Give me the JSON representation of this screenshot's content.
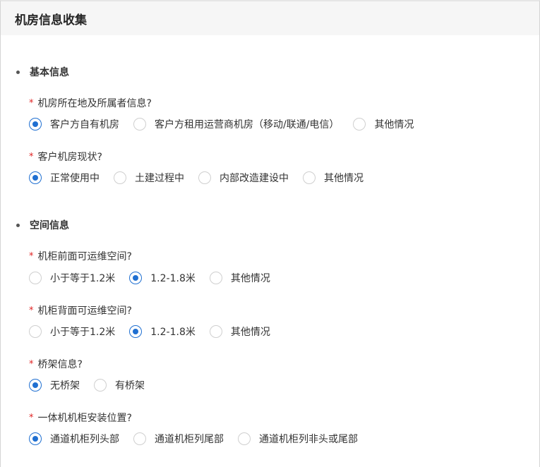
{
  "header": {
    "title": "机房信息收集"
  },
  "sections": [
    {
      "title": "基本信息"
    },
    {
      "title": "空间信息"
    }
  ],
  "questions": [
    {
      "required_mark": "*",
      "label": "机房所在地及所属者信息?",
      "options": [
        "客户方自有机房",
        "客户方租用运营商机房（移动/联通/电信）",
        "其他情况"
      ],
      "selected": 0
    },
    {
      "required_mark": "*",
      "label": "客户机房现状?",
      "options": [
        "正常使用中",
        "土建过程中",
        "内部改造建设中",
        "其他情况"
      ],
      "selected": 0
    },
    {
      "required_mark": "*",
      "label": "机柜前面可运维空间?",
      "options": [
        "小于等于1.2米",
        "1.2-1.8米",
        "其他情况"
      ],
      "selected": 1
    },
    {
      "required_mark": "*",
      "label": "机柜背面可运维空间?",
      "options": [
        "小于等于1.2米",
        "1.2-1.8米",
        "其他情况"
      ],
      "selected": 1
    },
    {
      "required_mark": "*",
      "label": "桥架信息?",
      "options": [
        "无桥架",
        "有桥架"
      ],
      "selected": 0
    },
    {
      "required_mark": "*",
      "label": "一体机机柜安装位置?",
      "options": [
        "通道机柜列头部",
        "通道机柜列尾部",
        "通道机柜列非头或尾部"
      ],
      "selected": 0
    }
  ],
  "colors": {
    "accent": "#1f6fd1",
    "required": "#e02424",
    "header_bg": "#f6f6f6"
  }
}
